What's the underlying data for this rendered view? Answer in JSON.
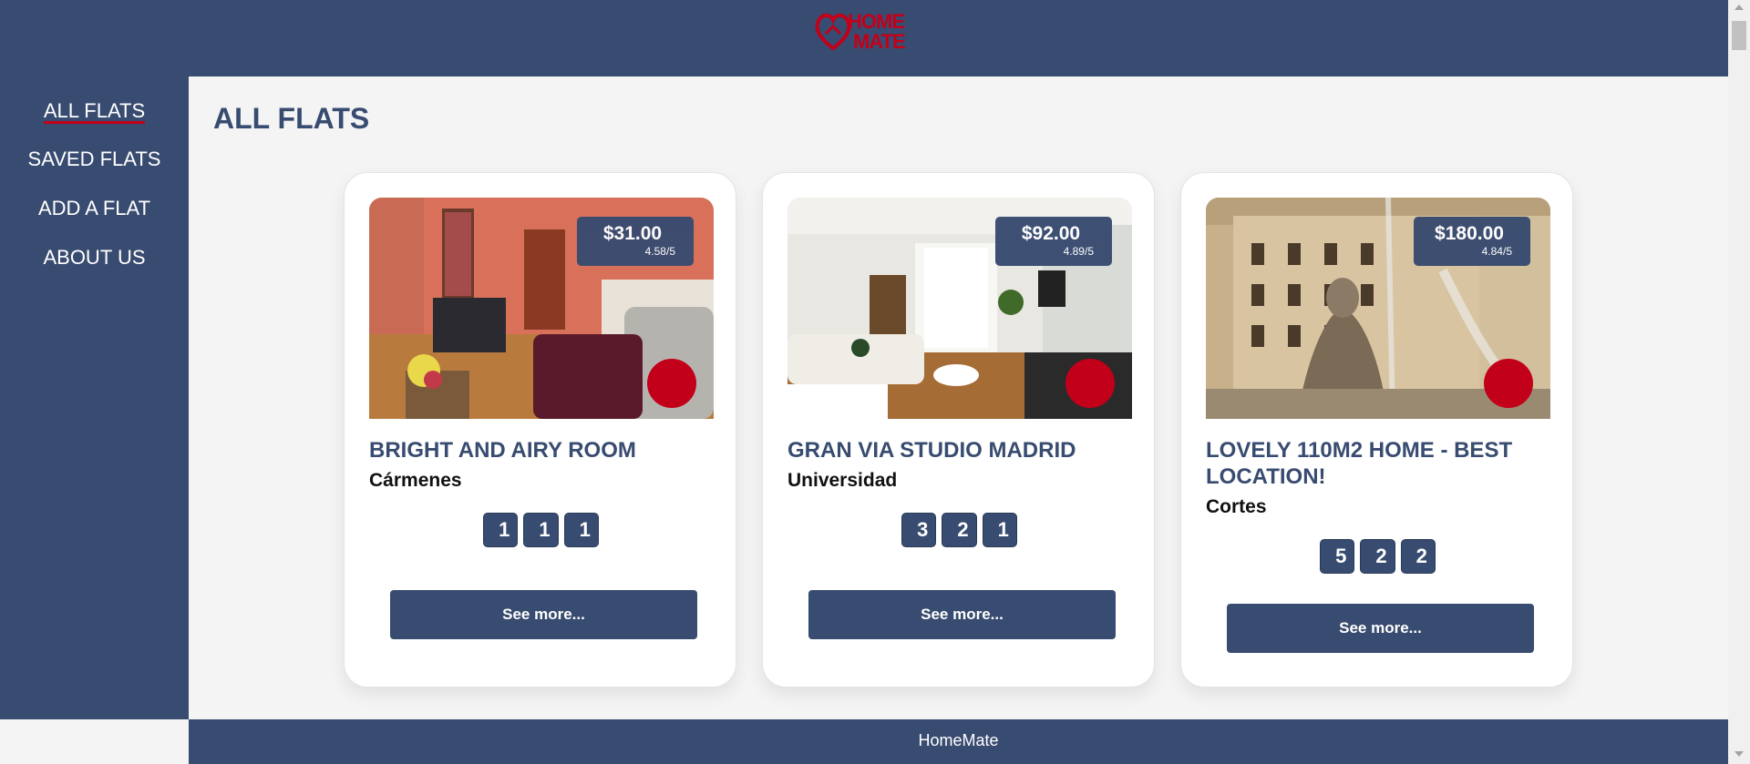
{
  "brand": {
    "logo_text_1": "HOME",
    "logo_text_2": "MATE",
    "color": "#c2001a",
    "primary": "#384b70"
  },
  "sidebar": {
    "items": [
      {
        "label": "ALL FLATS",
        "active": true
      },
      {
        "label": "SAVED FLATS",
        "active": false
      },
      {
        "label": "ADD A FLAT",
        "active": false
      },
      {
        "label": "ABOUT US",
        "active": false
      }
    ]
  },
  "main": {
    "title": "ALL FLATS",
    "cards": [
      {
        "price": "$31.00",
        "rating": "4.58/5",
        "title": "BRIGHT AND AIRY ROOM",
        "location": "Cármenes",
        "features": [
          {
            "icon": "bed-icon",
            "glyph": "",
            "value": "1"
          },
          {
            "icon": "bath-icon",
            "glyph": "",
            "value": "1"
          },
          {
            "icon": "door-icon",
            "glyph": "",
            "value": "1"
          }
        ],
        "favorite_glyph": "",
        "button": "See more...",
        "image": "living-room-photo"
      },
      {
        "price": "$92.00",
        "rating": "4.89/5",
        "title": "GRAN VIA STUDIO MADRID",
        "location": "Universidad",
        "features": [
          {
            "icon": "bed-icon",
            "glyph": "",
            "value": "3"
          },
          {
            "icon": "bath-icon",
            "glyph": "",
            "value": "2"
          },
          {
            "icon": "door-icon",
            "glyph": "",
            "value": "1"
          }
        ],
        "favorite_glyph": "",
        "button": "See more...",
        "image": "studio-photo"
      },
      {
        "price": "$180.00",
        "rating": "4.84/5",
        "title": "LOVELY 110M2 HOME - BEST LOCATION!",
        "location": "Cortes",
        "features": [
          {
            "icon": "bed-icon",
            "glyph": "",
            "value": "5"
          },
          {
            "icon": "bath-icon",
            "glyph": "",
            "value": "2"
          },
          {
            "icon": "door-icon",
            "glyph": "",
            "value": "2"
          }
        ],
        "favorite_glyph": "",
        "button": "See more...",
        "image": "fountain-building-photo"
      }
    ]
  },
  "footer": {
    "text": "HomeMate"
  }
}
